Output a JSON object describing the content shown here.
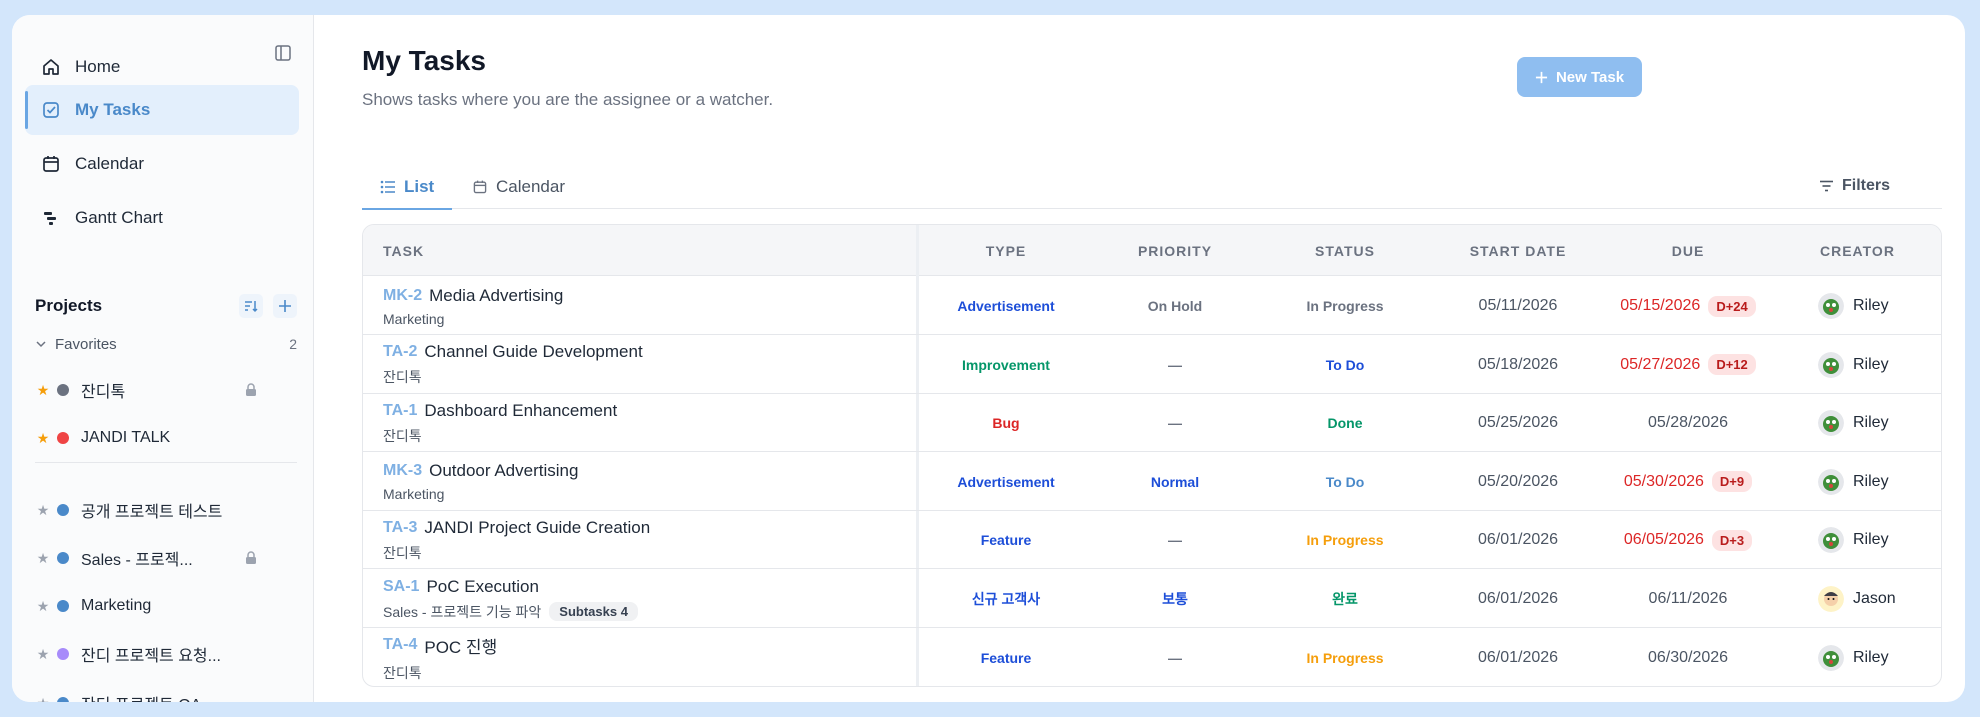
{
  "colors": {
    "accent": "#4a89c9",
    "new_task_bg": "#8fbef0",
    "overdue": "#dc2626"
  },
  "sidebar": {
    "nav": [
      {
        "label": "Home",
        "icon": "home-icon"
      },
      {
        "label": "My Tasks",
        "icon": "checkbox-icon"
      },
      {
        "label": "Calendar",
        "icon": "calendar-icon"
      },
      {
        "label": "Gantt Chart",
        "icon": "gantt-icon"
      }
    ],
    "projects_title": "Projects",
    "favorites_label": "Favorites",
    "favorites_count": "2",
    "favorite_projects": [
      {
        "name": "잔디톡",
        "color": "#6b7280",
        "locked": true
      },
      {
        "name": "JANDI TALK",
        "color": "#ef4444",
        "locked": false
      }
    ],
    "projects": [
      {
        "name": "공개 프로젝트 테스트",
        "color": "#4a89c9",
        "locked": false
      },
      {
        "name": "Sales - 프로젝...",
        "color": "#4a89c9",
        "locked": true
      },
      {
        "name": "Marketing",
        "color": "#4a89c9",
        "locked": false
      },
      {
        "name": "잔디 프로젝트 요청...",
        "color": "#a78bfa",
        "locked": false
      },
      {
        "name": "잔디 프로젝트 QA",
        "color": "#4a89c9",
        "locked": false
      }
    ]
  },
  "header": {
    "title": "My Tasks",
    "subtitle": "Shows tasks where you are the assignee or a watcher.",
    "new_task_label": "New Task"
  },
  "tabs": [
    {
      "label": "List"
    },
    {
      "label": "Calendar"
    }
  ],
  "filters_label": "Filters",
  "table": {
    "columns": [
      "TASK",
      "TYPE",
      "PRIORITY",
      "STATUS",
      "START DATE",
      "DUE",
      "CREATOR"
    ],
    "rows": [
      {
        "key": "MK-2",
        "name": "Media Advertising",
        "project": "Marketing",
        "subtasks": "",
        "type": "Advertisement",
        "type_color": "#1d4ed8",
        "priority": "On Hold",
        "priority_color": "#6b7280",
        "status": "In Progress",
        "status_color": "#6b7280",
        "start": "05/11/2026",
        "due": "05/15/2026",
        "due_overdue": true,
        "dday": "D+24",
        "creator": "Riley",
        "avatar": "riley"
      },
      {
        "key": "TA-2",
        "name": "Channel Guide Development",
        "project": "잔디톡",
        "subtasks": "",
        "type": "Improvement",
        "type_color": "#059669",
        "priority": "—",
        "priority_color": "#6b7280",
        "status": "To Do",
        "status_color": "#1d4ed8",
        "start": "05/18/2026",
        "due": "05/27/2026",
        "due_overdue": true,
        "dday": "D+12",
        "creator": "Riley",
        "avatar": "riley"
      },
      {
        "key": "TA-1",
        "name": "Dashboard Enhancement",
        "project": "잔디톡",
        "subtasks": "",
        "type": "Bug",
        "type_color": "#dc2626",
        "priority": "—",
        "priority_color": "#6b7280",
        "status": "Done",
        "status_color": "#059669",
        "start": "05/25/2026",
        "due": "05/28/2026",
        "due_overdue": false,
        "dday": "",
        "creator": "Riley",
        "avatar": "riley"
      },
      {
        "key": "MK-3",
        "name": "Outdoor Advertising",
        "project": "Marketing",
        "subtasks": "",
        "type": "Advertisement",
        "type_color": "#1d4ed8",
        "priority": "Normal",
        "priority_color": "#1d4ed8",
        "status": "To Do",
        "status_color": "#4a89c9",
        "start": "05/20/2026",
        "due": "05/30/2026",
        "due_overdue": true,
        "dday": "D+9",
        "creator": "Riley",
        "avatar": "riley"
      },
      {
        "key": "TA-3",
        "name": "JANDI Project Guide Creation",
        "project": "잔디톡",
        "subtasks": "",
        "type": "Feature",
        "type_color": "#1d4ed8",
        "priority": "—",
        "priority_color": "#6b7280",
        "status": "In Progress",
        "status_color": "#f59e0b",
        "start": "06/01/2026",
        "due": "06/05/2026",
        "due_overdue": true,
        "dday": "D+3",
        "creator": "Riley",
        "avatar": "riley"
      },
      {
        "key": "SA-1",
        "name": "PoC Execution",
        "project": "Sales - 프로젝트 기능 파악",
        "subtasks": "Subtasks 4",
        "type": "신규 고객사",
        "type_color": "#1d4ed8",
        "priority": "보통",
        "priority_color": "#1d4ed8",
        "status": "완료",
        "status_color": "#059669",
        "start": "06/01/2026",
        "due": "06/11/2026",
        "due_overdue": false,
        "dday": "",
        "creator": "Jason",
        "avatar": "jason"
      },
      {
        "key": "TA-4",
        "name": "POC 진행",
        "project": "잔디톡",
        "subtasks": "",
        "type": "Feature",
        "type_color": "#1d4ed8",
        "priority": "—",
        "priority_color": "#6b7280",
        "status": "In Progress",
        "status_color": "#f59e0b",
        "start": "06/01/2026",
        "due": "06/30/2026",
        "due_overdue": false,
        "dday": "",
        "creator": "Riley",
        "avatar": "riley"
      }
    ]
  }
}
